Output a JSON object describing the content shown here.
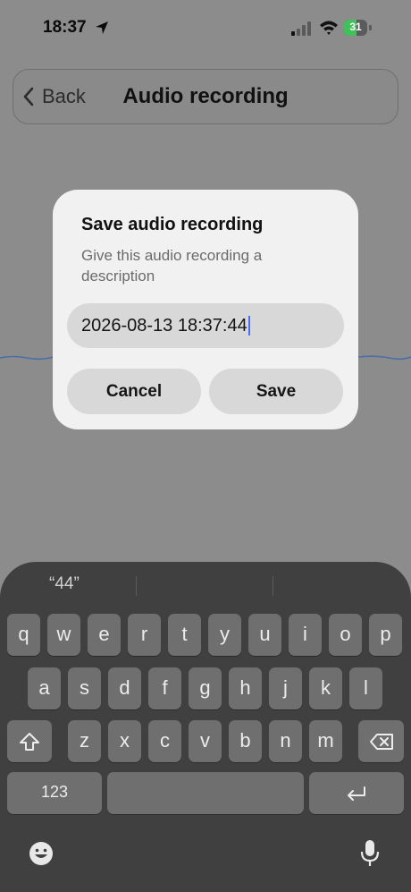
{
  "status_bar": {
    "time": "18:37",
    "battery": "31"
  },
  "nav": {
    "back_label": "Back",
    "title": "Audio recording"
  },
  "dialog": {
    "title": "Save audio recording",
    "message": "Give this audio recording a description",
    "field_value": "2026-08-13 18:37:44",
    "cancel_label": "Cancel",
    "save_label": "Save"
  },
  "keyboard": {
    "suggestion": "“44”",
    "row1": [
      "q",
      "w",
      "e",
      "r",
      "t",
      "y",
      "u",
      "i",
      "o",
      "p"
    ],
    "row2": [
      "a",
      "s",
      "d",
      "f",
      "g",
      "h",
      "j",
      "k",
      "l"
    ],
    "row3": [
      "z",
      "x",
      "c",
      "v",
      "b",
      "n",
      "m"
    ],
    "numbers_label": "123"
  },
  "colors": {
    "battery_green": "#3fc25a",
    "caret_blue": "#4a6cf7",
    "waveform_blue": "#4a6fa8"
  }
}
